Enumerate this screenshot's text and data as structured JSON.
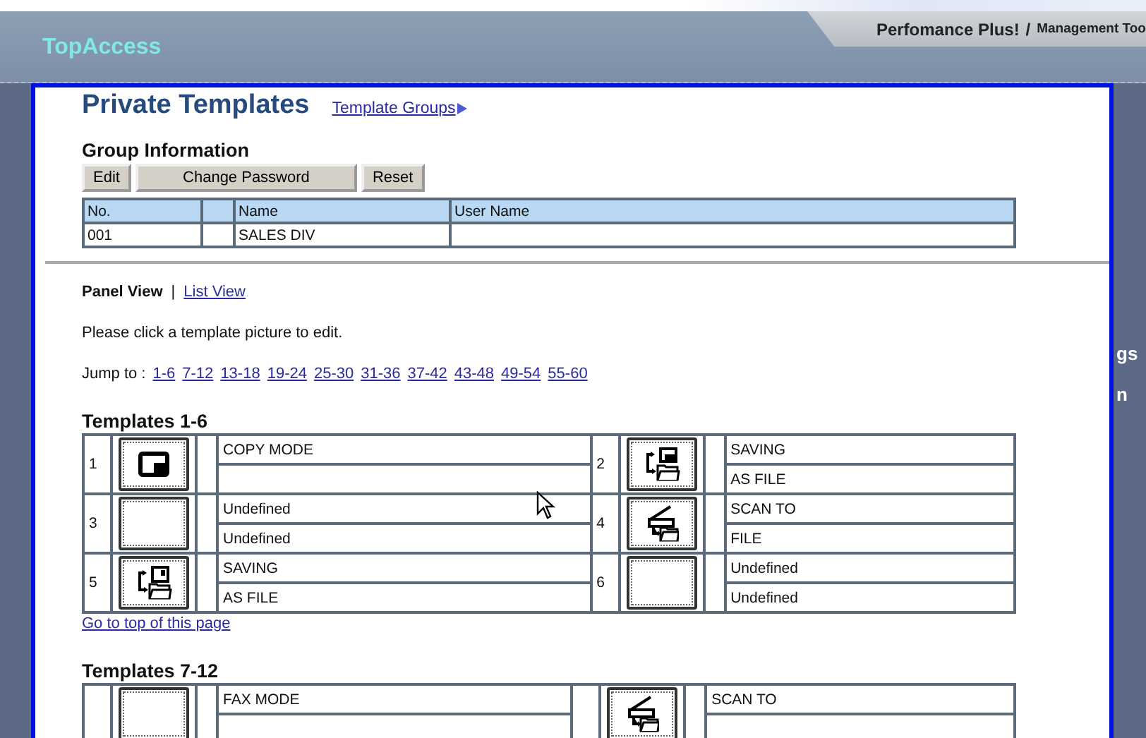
{
  "header": {
    "brand": "TopAccess",
    "tool_title": "Perfomance Plus!",
    "tool_separator": "/",
    "tool_subtitle": "Management Too"
  },
  "page": {
    "title": "Private Templates",
    "groups_link": "Template Groups"
  },
  "group_info": {
    "heading": "Group Information",
    "buttons": [
      "Edit",
      "Change Password",
      "Reset"
    ],
    "columns": [
      "No.",
      "",
      "Name",
      "User Name"
    ],
    "rows": [
      [
        "001",
        "",
        "SALES DIV",
        ""
      ]
    ]
  },
  "views": [
    {
      "label": "Panel View",
      "selected": true
    },
    {
      "label": "List View",
      "selected": false
    }
  ],
  "view_separator": "|",
  "instruction": "Please click a template picture to edit.",
  "jump": {
    "label": "Jump to :",
    "links": [
      "1-6",
      "7-12",
      "13-18",
      "19-24",
      "25-30",
      "31-36",
      "37-42",
      "43-48",
      "49-54",
      "55-60"
    ]
  },
  "sections": [
    {
      "heading": "Templates 1-6",
      "templates": [
        {
          "number": "1",
          "kind": "copy",
          "lines": [
            "COPY MODE"
          ]
        },
        {
          "number": "2",
          "kind": "save-file",
          "lines": [
            "SAVING",
            "AS FILE"
          ]
        },
        {
          "number": "3",
          "kind": "empty",
          "lines": [
            "Undefined",
            "Undefined"
          ]
        },
        {
          "number": "4",
          "kind": "scan-file",
          "lines": [
            "SCAN TO",
            "FILE"
          ]
        },
        {
          "number": "5",
          "kind": "save-box",
          "lines": [
            "SAVING",
            "AS FILE"
          ]
        },
        {
          "number": "6",
          "kind": "empty",
          "lines": [
            "Undefined",
            "Undefined"
          ]
        }
      ],
      "top_link": "Go to top of this page"
    },
    {
      "heading": "Templates 7-12",
      "templates": [
        {
          "kind": "empty",
          "lines": [
            "FAX MODE"
          ]
        },
        {
          "kind": "scan-file",
          "lines": [
            "SCAN TO"
          ]
        }
      ]
    }
  ],
  "side_fragments": [
    "gs",
    "n"
  ]
}
